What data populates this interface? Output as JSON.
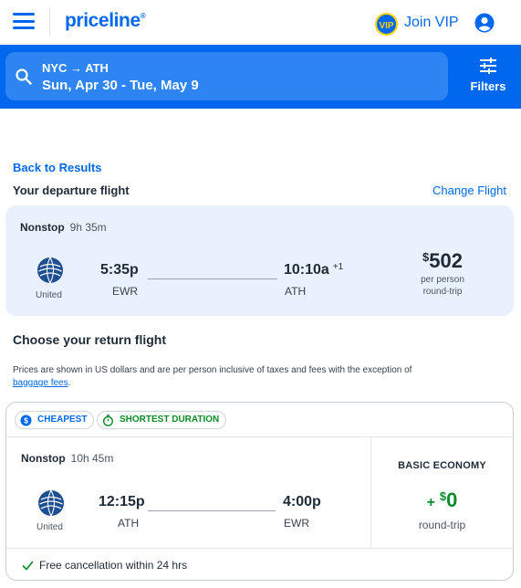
{
  "header": {
    "logo": "priceline",
    "logo_mark": "®",
    "vip_badge": "VIP",
    "join_vip": "Join VIP",
    "menu_icon": "hamburger-menu-icon",
    "user_icon": "user-account-icon"
  },
  "search": {
    "route": "NYC → ATH",
    "dates": "Sun, Apr 30 - Tue, May 9",
    "filters_label": "Filters"
  },
  "nav": {
    "back": "Back to Results",
    "departure_heading": "Your departure flight",
    "change_flight": "Change Flight"
  },
  "departure": {
    "stops": "Nonstop",
    "duration": "9h 35m",
    "airline": "United",
    "depart_time": "5:35p",
    "depart_airport": "EWR",
    "arrive_time": "10:10a",
    "day_offset": "+1",
    "arrive_airport": "ATH",
    "price_currency": "$",
    "price": "502",
    "price_note_1": "per person",
    "price_note_2": "round-trip"
  },
  "return_section": {
    "heading": "Choose your return flight",
    "disclaimer": "Prices are shown in US dollars and are per person inclusive of taxes and fees with the exception of",
    "baggage_link": "baggage fees",
    "disclaimer_end": "."
  },
  "return_flight": {
    "badge_cheapest": "CHEAPEST",
    "badge_shortest": "SHORTEST DURATION",
    "stops": "Nonstop",
    "duration": "10h 45m",
    "airline": "United",
    "depart_time": "12:15p",
    "depart_airport": "ATH",
    "arrive_time": "4:00p",
    "arrive_airport": "EWR",
    "fare_class": "BASIC ECONOMY",
    "price_prefix": "+",
    "price_currency": "$",
    "price": "0",
    "price_note": "round-trip",
    "cancellation": "Free cancellation within 24 hrs"
  },
  "colors": {
    "brand_blue": "#0068ef",
    "card_blue": "#e8f1fd",
    "success_green": "#0a8a2a",
    "vip_yellow": "#ffd200"
  }
}
